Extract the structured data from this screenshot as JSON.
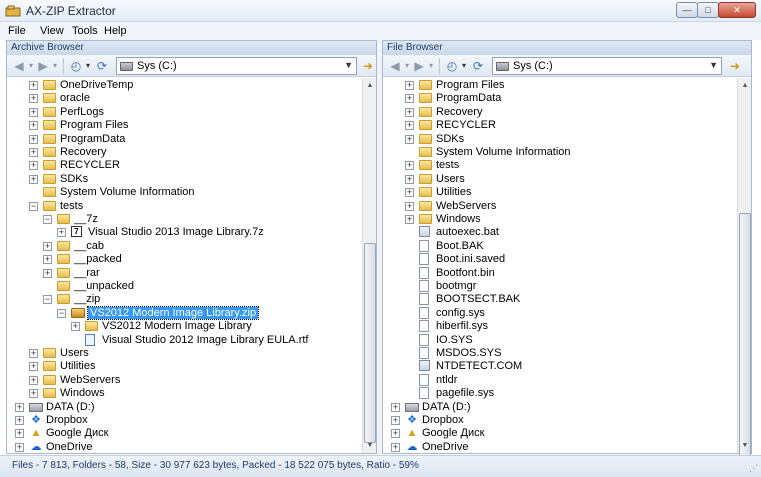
{
  "window": {
    "title": "AX-ZIP Extractor",
    "controls": {
      "minimize": "—",
      "maximize": "□",
      "close": "✕"
    }
  },
  "menu": [
    {
      "label": "File"
    },
    {
      "label": "View"
    },
    {
      "label": "Tools"
    },
    {
      "label": "Help"
    }
  ],
  "archive_browser": {
    "header": "Archive Browser",
    "drive": "Sys (C:)",
    "tree": [
      {
        "label": "OneDriveTemp",
        "icon": "folder-icon",
        "indent": 1,
        "expander": "+"
      },
      {
        "label": "oracle",
        "icon": "folder-icon",
        "indent": 1,
        "expander": "+"
      },
      {
        "label": "PerfLogs",
        "icon": "folder-icon",
        "indent": 1,
        "expander": "+"
      },
      {
        "label": "Program Files",
        "icon": "folder-icon",
        "indent": 1,
        "expander": "+"
      },
      {
        "label": "ProgramData",
        "icon": "folder-icon",
        "indent": 1,
        "expander": "+"
      },
      {
        "label": "Recovery",
        "icon": "folder-icon",
        "indent": 1,
        "expander": "+"
      },
      {
        "label": "RECYCLER",
        "icon": "folder-icon",
        "indent": 1,
        "expander": "+"
      },
      {
        "label": "SDKs",
        "icon": "folder-icon",
        "indent": 1,
        "expander": "+"
      },
      {
        "label": "System Volume Information",
        "icon": "folder-icon",
        "indent": 1,
        "expander": ""
      },
      {
        "label": "tests",
        "icon": "folder-icon",
        "indent": 1,
        "expander": "−"
      },
      {
        "label": "__7z",
        "icon": "folder-icon",
        "indent": 2,
        "expander": "−"
      },
      {
        "label": "Visual Studio 2013 Image Library.7z",
        "icon": "7z-file-icon",
        "indent": 3,
        "expander": "+"
      },
      {
        "label": "__cab",
        "icon": "folder-icon",
        "indent": 2,
        "expander": "+"
      },
      {
        "label": "__packed",
        "icon": "folder-icon",
        "indent": 2,
        "expander": "+"
      },
      {
        "label": "__rar",
        "icon": "folder-icon",
        "indent": 2,
        "expander": "+"
      },
      {
        "label": "__unpacked",
        "icon": "folder-icon",
        "indent": 2,
        "expander": ""
      },
      {
        "label": "__zip",
        "icon": "folder-icon",
        "indent": 2,
        "expander": "−"
      },
      {
        "label": "VS2012 Modern Image Library.zip",
        "icon": "zip-file-icon",
        "indent": 3,
        "expander": "−",
        "selected": true
      },
      {
        "label": "VS2012 Modern Image Library",
        "icon": "folder-icon",
        "indent": 4,
        "expander": "+"
      },
      {
        "label": "Visual Studio 2012 Image Library EULA.rtf",
        "icon": "rtf-file-icon",
        "indent": 4,
        "expander": ""
      },
      {
        "label": "Users",
        "icon": "folder-icon",
        "indent": 1,
        "expander": "+"
      },
      {
        "label": "Utilities",
        "icon": "folder-icon",
        "indent": 1,
        "expander": "+"
      },
      {
        "label": "WebServers",
        "icon": "folder-icon",
        "indent": 1,
        "expander": "+"
      },
      {
        "label": "Windows",
        "icon": "folder-icon",
        "indent": 1,
        "expander": "+"
      },
      {
        "label": "DATA (D:)",
        "icon": "drive-icon",
        "indent": 0,
        "expander": "+"
      },
      {
        "label": "Dropbox",
        "icon": "dropbox-icon",
        "indent": 0,
        "expander": "+"
      },
      {
        "label": "Google Диск",
        "icon": "google-drive-icon",
        "indent": 0,
        "expander": "+"
      },
      {
        "label": "OneDrive",
        "icon": "onedrive-icon",
        "indent": 0,
        "expander": "+"
      }
    ]
  },
  "file_browser": {
    "header": "File Browser",
    "drive": "Sys (C:)",
    "tree": [
      {
        "label": "Program Files",
        "icon": "folder-icon",
        "indent": 1,
        "expander": "+"
      },
      {
        "label": "ProgramData",
        "icon": "folder-icon",
        "indent": 1,
        "expander": "+"
      },
      {
        "label": "Recovery",
        "icon": "folder-icon",
        "indent": 1,
        "expander": "+"
      },
      {
        "label": "RECYCLER",
        "icon": "folder-icon",
        "indent": 1,
        "expander": "+"
      },
      {
        "label": "SDKs",
        "icon": "folder-icon",
        "indent": 1,
        "expander": "+"
      },
      {
        "label": "System Volume Information",
        "icon": "folder-icon",
        "indent": 1,
        "expander": ""
      },
      {
        "label": "tests",
        "icon": "folder-icon",
        "indent": 1,
        "expander": "+"
      },
      {
        "label": "Users",
        "icon": "folder-icon",
        "indent": 1,
        "expander": "+"
      },
      {
        "label": "Utilities",
        "icon": "folder-icon",
        "indent": 1,
        "expander": "+"
      },
      {
        "label": "WebServers",
        "icon": "folder-icon",
        "indent": 1,
        "expander": "+"
      },
      {
        "label": "Windows",
        "icon": "folder-icon",
        "indent": 1,
        "expander": "+"
      },
      {
        "label": "autoexec.bat",
        "icon": "bat-file-icon",
        "indent": 1,
        "expander": ""
      },
      {
        "label": "Boot.BAK",
        "icon": "file-icon",
        "indent": 1,
        "expander": ""
      },
      {
        "label": "Boot.ini.saved",
        "icon": "file-icon",
        "indent": 1,
        "expander": ""
      },
      {
        "label": "Bootfont.bin",
        "icon": "file-icon",
        "indent": 1,
        "expander": ""
      },
      {
        "label": "bootmgr",
        "icon": "system-file-icon",
        "indent": 1,
        "expander": ""
      },
      {
        "label": "BOOTSECT.BAK",
        "icon": "file-icon",
        "indent": 1,
        "expander": ""
      },
      {
        "label": "config.sys",
        "icon": "system-file-icon",
        "indent": 1,
        "expander": ""
      },
      {
        "label": "hiberfil.sys",
        "icon": "system-file-icon",
        "indent": 1,
        "expander": ""
      },
      {
        "label": "IO.SYS",
        "icon": "system-file-icon",
        "indent": 1,
        "expander": ""
      },
      {
        "label": "MSDOS.SYS",
        "icon": "system-file-icon",
        "indent": 1,
        "expander": ""
      },
      {
        "label": "NTDETECT.COM",
        "icon": "exe-file-icon",
        "indent": 1,
        "expander": ""
      },
      {
        "label": "ntldr",
        "icon": "system-file-icon",
        "indent": 1,
        "expander": ""
      },
      {
        "label": "pagefile.sys",
        "icon": "system-file-icon",
        "indent": 1,
        "expander": ""
      },
      {
        "label": "DATA (D:)",
        "icon": "drive-icon",
        "indent": 0,
        "expander": "+"
      },
      {
        "label": "Dropbox",
        "icon": "dropbox-icon",
        "indent": 0,
        "expander": "+"
      },
      {
        "label": "Google Диск",
        "icon": "google-drive-icon",
        "indent": 0,
        "expander": "+"
      },
      {
        "label": "OneDrive",
        "icon": "onedrive-icon",
        "indent": 0,
        "expander": "+"
      }
    ]
  },
  "status": "Files - 7 813, Folders - 58, Size - 30 977 623 bytes, Packed - 18 522 075 bytes, Ratio - 59%",
  "colors": {
    "selection": "#3399ff",
    "header_text": "#1c3c6c",
    "folder": "#e7bd4c"
  }
}
